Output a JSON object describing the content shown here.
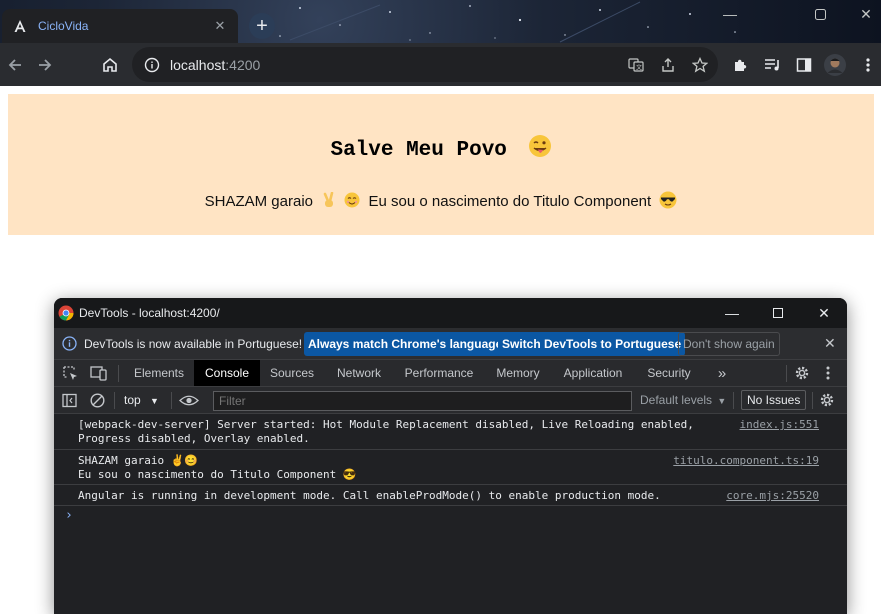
{
  "browser": {
    "tab": {
      "title": "CicloVida",
      "favicon": "angular-icon"
    },
    "new_tab_label": "+",
    "address": {
      "host": "localhost",
      "port": ":4200"
    },
    "window_controls": {
      "minimize": "—",
      "restore": "❐",
      "close": "✕"
    }
  },
  "page": {
    "title": "Salve Meu Povo",
    "title_emoji": "😜",
    "subtitle_part1": "SHAZAM garaio",
    "subtitle_emojis": "✌️😊",
    "subtitle_part2": "Eu sou o nascimento do Titulo Component",
    "subtitle_end_emoji": "😎",
    "background_color": "#ffe4c4"
  },
  "devtools": {
    "window_title": "DevTools - localhost:4200/",
    "infobar": {
      "message": "DevTools is now available in Portuguese!",
      "btn_match": "Always match Chrome's language",
      "btn_switch": "Switch DevTools to Portuguese",
      "btn_dismiss": "Don't show again"
    },
    "panels": [
      "Elements",
      "Console",
      "Sources",
      "Network",
      "Performance",
      "Memory",
      "Application",
      "Security"
    ],
    "active_panel": "Console",
    "more_panels": "»",
    "console_bar": {
      "context": "top",
      "filter_placeholder": "Filter",
      "levels": "Default levels",
      "issues": "No Issues"
    },
    "logs": [
      {
        "line1": "[webpack-dev-server] Server started: Hot Module Replacement disabled, Live Reloading enabled,",
        "line2": "Progress disabled, Overlay enabled.",
        "source": "index.js:551"
      },
      {
        "line1": "SHAZAM garaio ✌️😊",
        "line2": "Eu sou o nascimento do Titulo Component 😎",
        "source": "titulo.component.ts:19"
      },
      {
        "line1": "Angular is running in development mode. Call enableProdMode() to enable production mode.",
        "line2": "",
        "source": "core.mjs:25520"
      }
    ],
    "prompt_symbol": "›"
  }
}
